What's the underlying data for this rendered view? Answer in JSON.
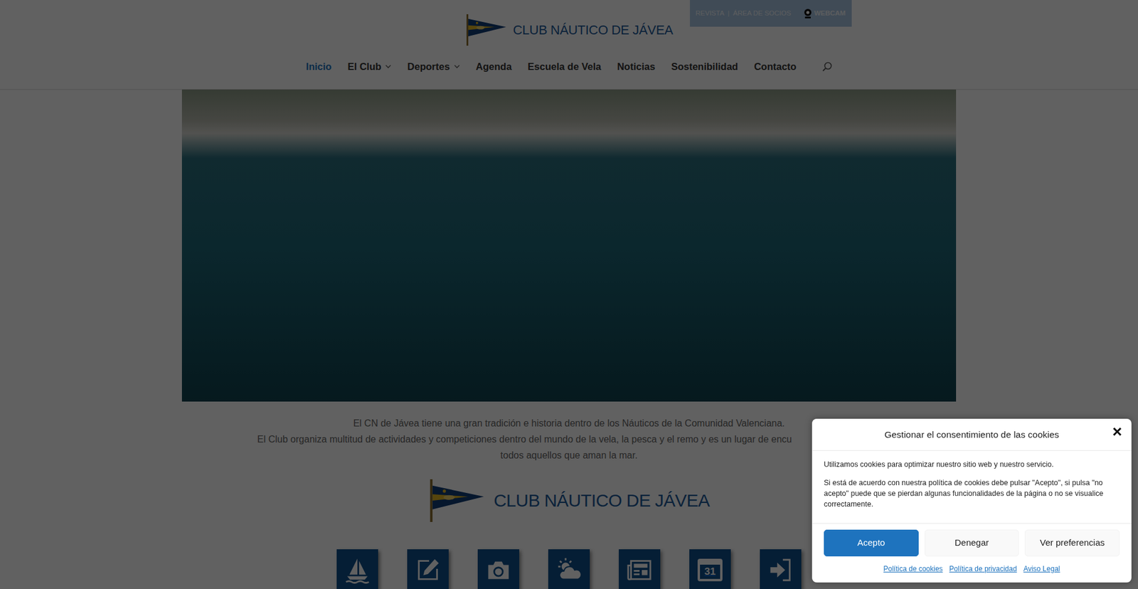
{
  "topbar": {
    "links": [
      "REVISTA",
      "ÁREA DE SOCIOS"
    ],
    "separator": "|",
    "webcam": "WEBCAM"
  },
  "header": {
    "logo_text": "CLUB NÁUTICO DE JÁVEA"
  },
  "nav": {
    "items": [
      {
        "label": "Inicio",
        "selected": true,
        "has_submenu": false
      },
      {
        "label": "El Club",
        "selected": false,
        "has_submenu": true
      },
      {
        "label": "Deportes",
        "selected": false,
        "has_submenu": true
      },
      {
        "label": "Agenda",
        "selected": false,
        "has_submenu": false
      },
      {
        "label": "Escuela de Vela",
        "selected": false,
        "has_submenu": false
      },
      {
        "label": "Noticias",
        "selected": false,
        "has_submenu": false
      },
      {
        "label": "Sostenibilidad",
        "selected": false,
        "has_submenu": false
      },
      {
        "label": "Contacto",
        "selected": false,
        "has_submenu": false
      }
    ]
  },
  "intro": {
    "lines": [
      "El CN de Jávea tiene una gran tradición e historia dentro de los Náuticos de la Comunidad Valenciana.",
      "El Club organiza multitud de actividades y competiciones dentro del mundo de la vela, la pesca y el remo y es un lugar de encu",
      "todos aquellos que aman la mar."
    ]
  },
  "club_logo": {
    "text": "CLUB NÁUTICO DE JÁVEA"
  },
  "shortcuts": {
    "calendar_day": "31"
  },
  "cookie_dialog": {
    "title": "Gestionar el consentimiento de las cookies",
    "close": "×",
    "paragraphs": [
      "Utilizamos cookies para optimizar nuestro sitio web y nuestro servicio.",
      "Si está de acuerdo con nuestra política de cookies debe pulsar \"Acepto\", si pulsa \"no acepto\" puede que se pierdan algunas funcionalidades de la página o no se visualice correctamente."
    ],
    "buttons": [
      {
        "label": "Acepto",
        "kind": "primary"
      },
      {
        "label": "Denegar",
        "kind": "secondary"
      },
      {
        "label": "Ver preferencias",
        "kind": "secondary"
      }
    ],
    "links": [
      "Política de cookies",
      "Política de privacidad",
      "Aviso Legal"
    ]
  }
}
